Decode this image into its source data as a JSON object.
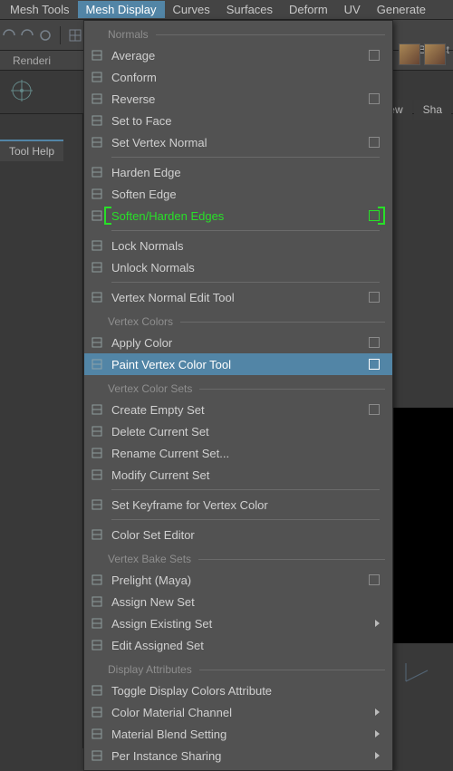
{
  "menubar": [
    {
      "label": "Mesh Tools"
    },
    {
      "label": "Mesh Display",
      "active": true
    },
    {
      "label": "Curves"
    },
    {
      "label": "Surfaces"
    },
    {
      "label": "Deform"
    },
    {
      "label": "UV"
    },
    {
      "label": "Generate"
    }
  ],
  "shelf_right_tab": "Bifrost",
  "shelf_left_tab": "Renderi",
  "left_panel_tab": "Tool Help",
  "viewport_tabs": [
    "View",
    "Sha"
  ],
  "dropdown": {
    "sections": [
      {
        "label": "Normals",
        "items": [
          {
            "label": "Average",
            "opt": true,
            "icon": "avg"
          },
          {
            "label": "Conform",
            "icon": "conf"
          },
          {
            "label": "Reverse",
            "opt": true,
            "icon": "rev"
          },
          {
            "label": "Set to Face",
            "icon": "stf"
          },
          {
            "label": "Set Vertex Normal",
            "opt": true,
            "icon": "svn"
          },
          {
            "divider": true
          },
          {
            "label": "Harden Edge",
            "icon": "he"
          },
          {
            "label": "Soften Edge",
            "icon": "se"
          },
          {
            "label": "Soften/Harden Edges",
            "opt": true,
            "green": true,
            "icon": "she"
          },
          {
            "divider": true
          },
          {
            "label": "Lock Normals",
            "icon": "ln"
          },
          {
            "label": "Unlock Normals",
            "icon": "un"
          },
          {
            "divider": true
          },
          {
            "label": "Vertex Normal Edit Tool",
            "opt": true,
            "icon": "vnet"
          }
        ]
      },
      {
        "label": "Vertex Colors",
        "items": [
          {
            "label": "Apply Color",
            "opt": true,
            "icon": "ac"
          },
          {
            "label": "Paint Vertex Color Tool",
            "opt": true,
            "hl": true,
            "icon": "pvct"
          }
        ]
      },
      {
        "label": "Vertex Color Sets",
        "items": [
          {
            "label": "Create Empty Set",
            "opt": true,
            "icon": "ces"
          },
          {
            "label": "Delete Current Set",
            "icon": "dcs"
          },
          {
            "label": "Rename Current Set...",
            "icon": "rcs"
          },
          {
            "label": "Modify Current Set",
            "icon": "mcs"
          },
          {
            "divider": true
          },
          {
            "label": "Set Keyframe for Vertex Color",
            "icon": "skvc"
          },
          {
            "divider": true
          },
          {
            "label": "Color Set Editor",
            "icon": "cse"
          }
        ]
      },
      {
        "label": "Vertex Bake Sets",
        "items": [
          {
            "label": "Prelight (Maya)",
            "opt": true,
            "icon": "plm"
          },
          {
            "label": "Assign New Set",
            "icon": "ans"
          },
          {
            "label": "Assign Existing Set",
            "submenu": true,
            "icon": "aes"
          },
          {
            "label": "Edit Assigned Set",
            "icon": "eas"
          }
        ]
      },
      {
        "label": "Display Attributes",
        "items": [
          {
            "label": "Toggle Display Colors Attribute",
            "icon": "tdca"
          },
          {
            "label": "Color Material Channel",
            "submenu": true,
            "icon": "cmc"
          },
          {
            "label": "Material Blend Setting",
            "submenu": true,
            "icon": "mbs"
          },
          {
            "label": "Per Instance Sharing",
            "submenu": true,
            "icon": "pis"
          }
        ]
      }
    ]
  }
}
